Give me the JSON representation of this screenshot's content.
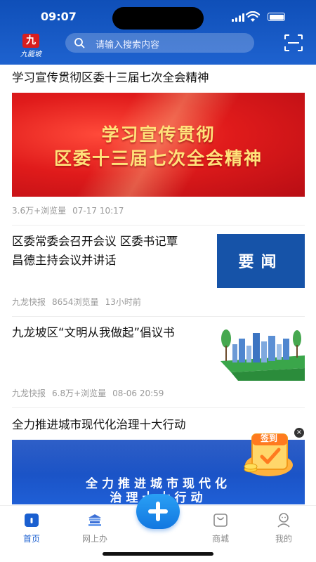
{
  "status": {
    "time": "09:07"
  },
  "header": {
    "logo_text": "九龍坡",
    "logo_mark": "九",
    "search_placeholder": "请输入搜索内容"
  },
  "feed": [
    {
      "title": "学习宣传贯彻区委十三届七次全会精神",
      "banner_lines": [
        "学习宣传贯彻",
        "区委十三届七次全会精神"
      ],
      "meta": [
        "3.6万+浏览量",
        "07-17 10:17"
      ]
    },
    {
      "title_lines": [
        "区委常委会召开会议 区委书记覃",
        "昌德主持会议并讲话"
      ],
      "thumb_text": "要闻",
      "meta": [
        "九龙快报",
        "8654浏览量",
        "13小时前"
      ]
    },
    {
      "title": "九龙坡区“文明从我做起”倡议书",
      "meta": [
        "九龙快报",
        "6.8万+浏览量",
        "08-06 20:59"
      ]
    },
    {
      "title": "全力推进城市现代化治理十大行动",
      "banner_lines": [
        "全力推进城市现代化",
        "治理十大行动"
      ]
    }
  ],
  "signin_badge": {
    "label": "签到",
    "close": "×"
  },
  "tabs": [
    {
      "label": "首页",
      "icon": "home-icon",
      "active": true
    },
    {
      "label": "网上办",
      "icon": "online-service-icon",
      "active": false
    },
    {
      "label": "商城",
      "icon": "mall-icon",
      "active": false
    },
    {
      "label": "我的",
      "icon": "profile-icon",
      "active": false
    }
  ],
  "colors": {
    "brand_blue": "#1a5fd0",
    "banner_red": "#e01b1b",
    "banner_yellow_text": "#ffe27a"
  }
}
